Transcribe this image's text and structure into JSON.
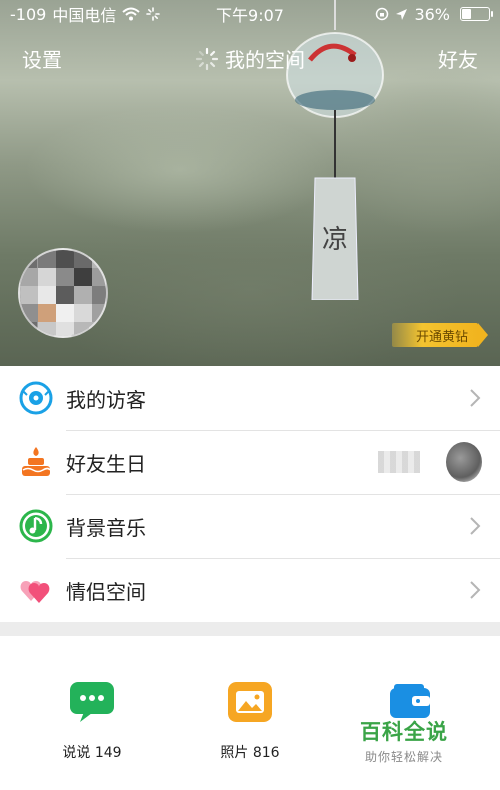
{
  "status_bar": {
    "signal": "-109",
    "carrier": "中国电信",
    "time": "下午9:07",
    "battery": "36%",
    "battery_level": 0.36
  },
  "nav": {
    "left": "设置",
    "title": "我的空间",
    "right": "好友"
  },
  "hero": {
    "chime_char": "凉",
    "vip_label": "开通黄钻"
  },
  "list": {
    "items": [
      {
        "label": "我的访客",
        "icon": "eye-icon",
        "color": "#1aa1e6"
      },
      {
        "label": "好友生日",
        "icon": "cake-icon",
        "color": "#f37521"
      },
      {
        "label": "背景音乐",
        "icon": "music-note-icon",
        "color": "#2cb64b"
      },
      {
        "label": "情侣空间",
        "icon": "hearts-icon",
        "color": "#f2507a"
      }
    ]
  },
  "grid": {
    "items": [
      {
        "label": "说说 149",
        "icon": "chat-bubble-icon",
        "color": "#23b25a"
      },
      {
        "label": "照片 816",
        "icon": "photo-icon",
        "color": "#f6a623"
      },
      {
        "label": "",
        "icon": "wallet-icon",
        "color": "#1a8fe3"
      }
    ]
  },
  "watermark": {
    "title": "百科全说",
    "subtitle": "助你轻松解决"
  }
}
